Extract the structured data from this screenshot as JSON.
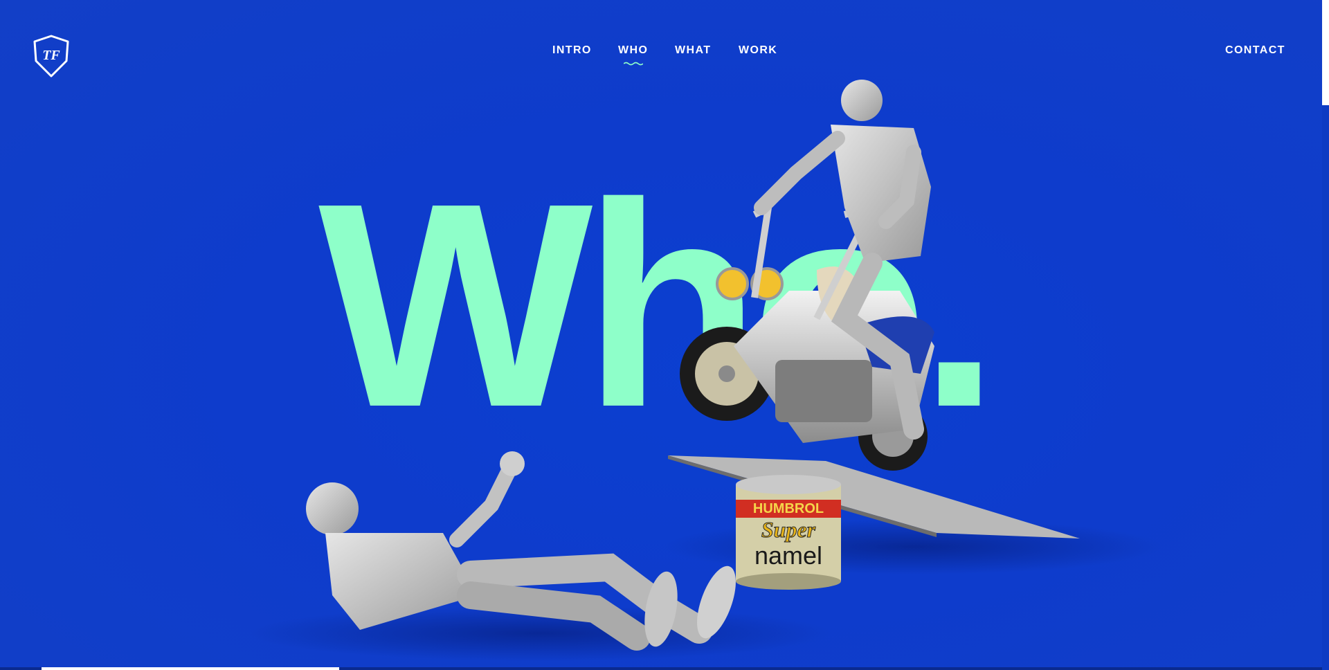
{
  "brand": {
    "logo_text": "TF"
  },
  "nav": {
    "items": [
      {
        "label": "INTRO",
        "active": false
      },
      {
        "label": "WHO",
        "active": true
      },
      {
        "label": "WHAT",
        "active": false
      },
      {
        "label": "WORK",
        "active": false
      }
    ],
    "contact_label": "CONTACT"
  },
  "hero": {
    "headline": "Who."
  },
  "scene": {
    "paint_tin_brand": "HUMBROL",
    "paint_tin_line1": "Super",
    "paint_tin_line2": "namel"
  },
  "colors": {
    "background": "#0e3ccc",
    "headline": "#8effc9",
    "nav_text": "#ffffff"
  }
}
